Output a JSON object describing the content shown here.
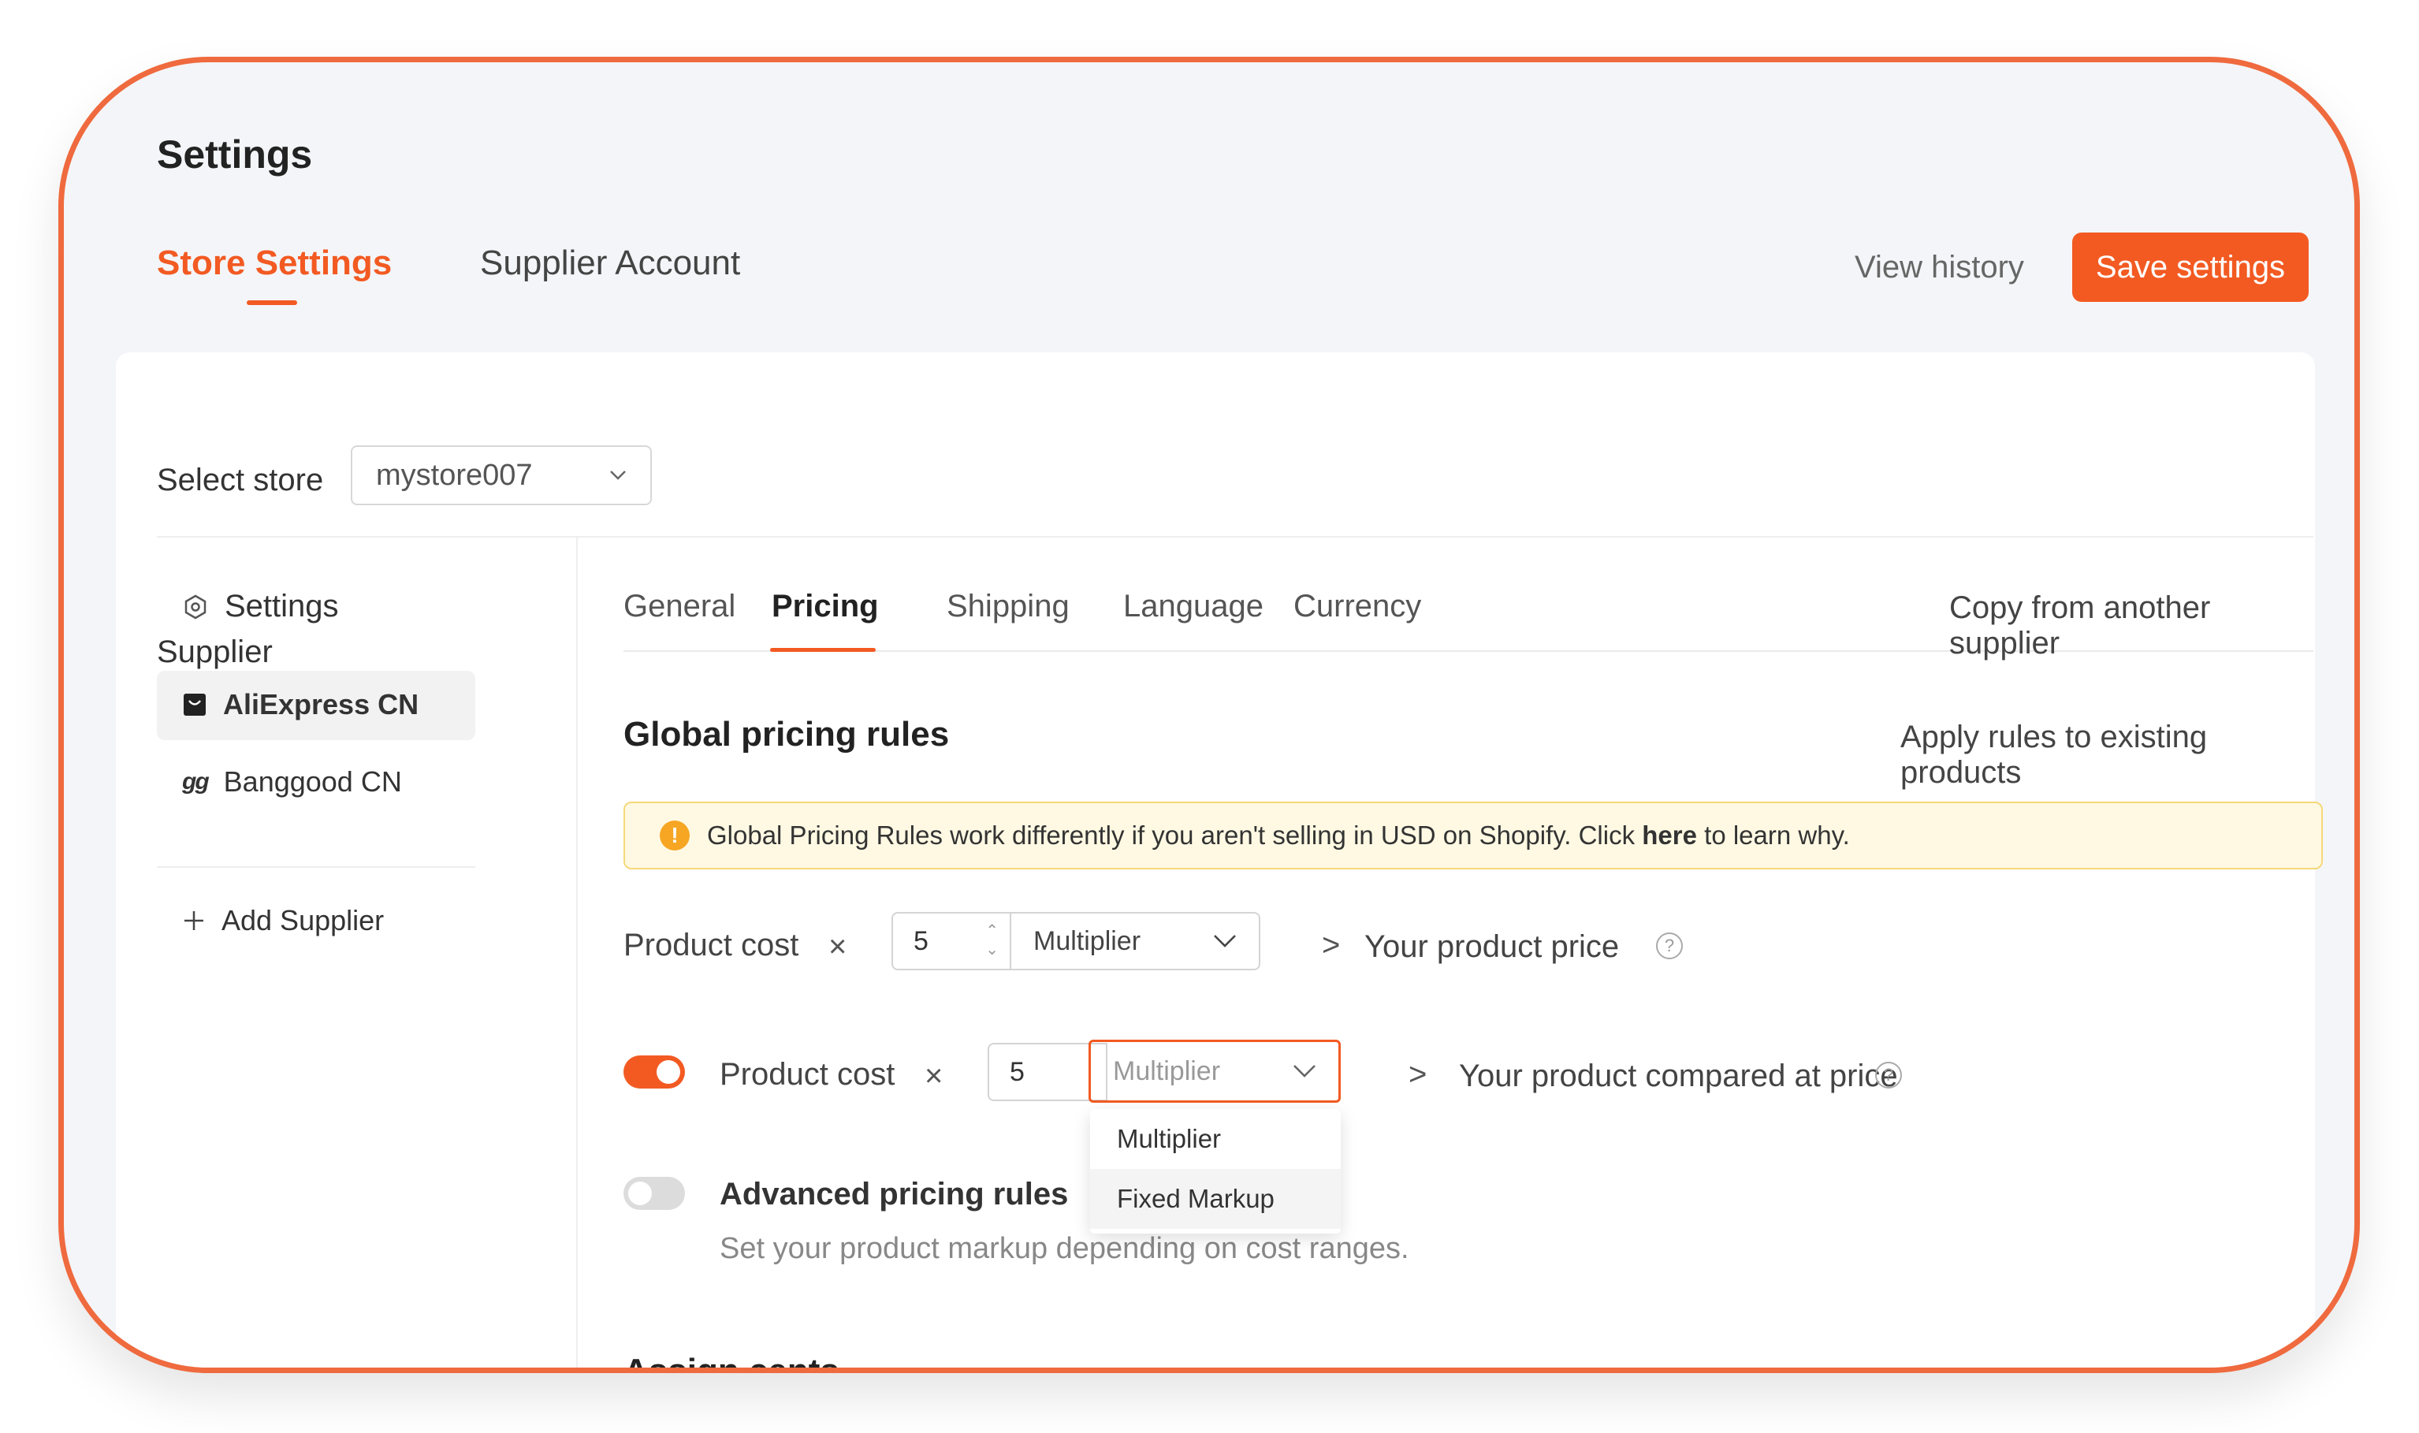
{
  "page": {
    "title": "Settings"
  },
  "top_tabs": [
    {
      "label": "Store Settings",
      "active": true
    },
    {
      "label": "Supplier Account",
      "active": false
    }
  ],
  "header_actions": {
    "view_history": "View history",
    "save": "Save settings"
  },
  "store_selector": {
    "label": "Select store",
    "value": "mystore007"
  },
  "sidebar": {
    "settings_label": "Settings",
    "supplier_heading": "Supplier",
    "suppliers": [
      {
        "label": "AliExpress CN",
        "active": true
      },
      {
        "label": "Banggood CN",
        "active": false
      }
    ],
    "add_supplier": "Add Supplier"
  },
  "sub_tabs": [
    {
      "label": "General",
      "active": false
    },
    {
      "label": "Pricing",
      "active": true
    },
    {
      "label": "Shipping",
      "active": false
    },
    {
      "label": "Language",
      "active": false
    },
    {
      "label": "Currency",
      "active": false
    }
  ],
  "copy_link": "Copy from another supplier",
  "global_rules": {
    "title": "Global pricing rules",
    "apply_link": "Apply rules to existing products",
    "notice": {
      "before": "Global Pricing Rules work differently if you aren't selling in USD on Shopify. Click",
      "link": "here",
      "after": "to learn why."
    },
    "row1": {
      "left_label": "Product cost",
      "times": "×",
      "value": "5",
      "mode": "Multiplier",
      "gt": ">",
      "result_label": "Your product price"
    },
    "row2": {
      "enabled": true,
      "left_label": "Product cost",
      "times": "×",
      "value": "5",
      "mode": "Multiplier",
      "gt": ">",
      "result_label": "Your product compared at price"
    },
    "dropdown_options": [
      "Multiplier",
      "Fixed Markup"
    ],
    "advanced": {
      "enabled": false,
      "title": "Advanced pricing rules",
      "description": "Set your product markup depending on cost ranges."
    }
  },
  "assign_cents": {
    "title": "Assign cents"
  },
  "colors": {
    "accent": "#f25a22",
    "frame": "#ef6a3e",
    "notice_bg": "#fff9e3"
  }
}
